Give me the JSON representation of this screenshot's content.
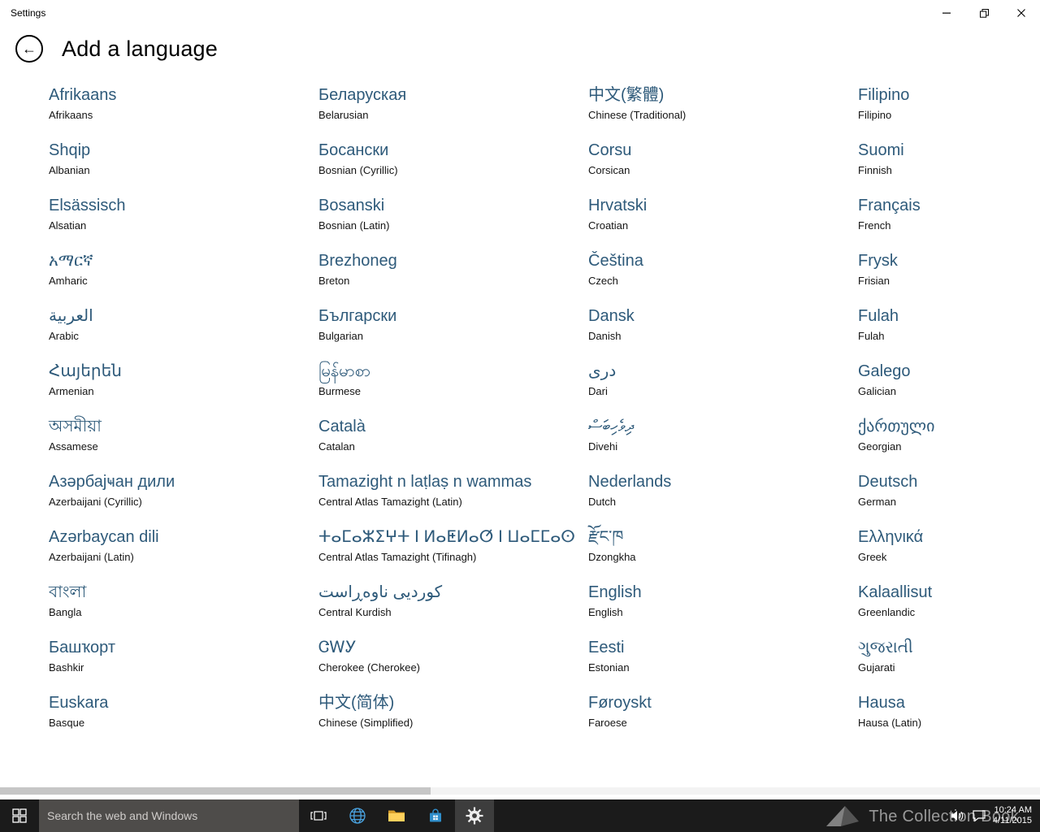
{
  "titlebar": {
    "app_name": "Settings"
  },
  "header": {
    "title": "Add a language"
  },
  "languages": {
    "columns": [
      [
        {
          "native": "Afrikaans",
          "english": "Afrikaans"
        },
        {
          "native": "Shqip",
          "english": "Albanian"
        },
        {
          "native": "Elsässisch",
          "english": "Alsatian"
        },
        {
          "native": "አማርኛ",
          "english": "Amharic"
        },
        {
          "native": "العربية",
          "english": "Arabic"
        },
        {
          "native": "Հայերեն",
          "english": "Armenian"
        },
        {
          "native": "অসমীয়া",
          "english": "Assamese"
        },
        {
          "native": "Азәрбајҹан дили",
          "english": "Azerbaijani (Cyrillic)"
        },
        {
          "native": "Azərbaycan dili",
          "english": "Azerbaijani (Latin)"
        },
        {
          "native": "বাংলা",
          "english": "Bangla"
        },
        {
          "native": "Башҡорт",
          "english": "Bashkir"
        },
        {
          "native": "Euskara",
          "english": "Basque"
        }
      ],
      [
        {
          "native": "Беларуская",
          "english": "Belarusian"
        },
        {
          "native": "Босански",
          "english": "Bosnian (Cyrillic)"
        },
        {
          "native": "Bosanski",
          "english": "Bosnian (Latin)"
        },
        {
          "native": "Brezhoneg",
          "english": "Breton"
        },
        {
          "native": "Български",
          "english": "Bulgarian"
        },
        {
          "native": "မြန်မာစာ",
          "english": "Burmese"
        },
        {
          "native": "Català",
          "english": "Catalan"
        },
        {
          "native": "Tamazight n laṭlaṣ n wammas",
          "english": "Central Atlas Tamazight (Latin)"
        },
        {
          "native": "ⵜⴰⵎⴰⵣⵉⵖⵜ ⵏ ⵍⴰⵟⵍⴰⵚ ⵏ ⵡⴰⵎⵎⴰⵙ",
          "english": "Central Atlas Tamazight (Tifinagh)"
        },
        {
          "native": "کوردیی ناوەڕاست",
          "english": "Central Kurdish"
        },
        {
          "native": "ᏣᎳᎩ",
          "english": "Cherokee (Cherokee)"
        },
        {
          "native": "中文(简体)",
          "english": "Chinese (Simplified)"
        }
      ],
      [
        {
          "native": "中文(繁體)",
          "english": "Chinese (Traditional)"
        },
        {
          "native": "Corsu",
          "english": "Corsican"
        },
        {
          "native": "Hrvatski",
          "english": "Croatian"
        },
        {
          "native": "Čeština",
          "english": "Czech"
        },
        {
          "native": "Dansk",
          "english": "Danish"
        },
        {
          "native": "دری",
          "english": "Dari"
        },
        {
          "native": "ދިވެހިބަސް",
          "english": "Divehi"
        },
        {
          "native": "Nederlands",
          "english": "Dutch"
        },
        {
          "native": "རྫོང་ཁ",
          "english": "Dzongkha"
        },
        {
          "native": "English",
          "english": "English"
        },
        {
          "native": "Eesti",
          "english": "Estonian"
        },
        {
          "native": "Føroyskt",
          "english": "Faroese"
        }
      ],
      [
        {
          "native": "Filipino",
          "english": "Filipino"
        },
        {
          "native": "Suomi",
          "english": "Finnish"
        },
        {
          "native": "Français",
          "english": "French"
        },
        {
          "native": "Frysk",
          "english": "Frisian"
        },
        {
          "native": "Fulah",
          "english": "Fulah"
        },
        {
          "native": "Galego",
          "english": "Galician"
        },
        {
          "native": "ქართული",
          "english": "Georgian"
        },
        {
          "native": "Deutsch",
          "english": "German"
        },
        {
          "native": "Ελληνικά",
          "english": "Greek"
        },
        {
          "native": "Kalaallisut",
          "english": "Greenlandic"
        },
        {
          "native": "ગુજરાતી",
          "english": "Gujarati"
        },
        {
          "native": "Hausa",
          "english": "Hausa (Latin)"
        }
      ]
    ]
  },
  "taskbar": {
    "search_placeholder": "Search the web and Windows",
    "clock": {
      "time": "10:24 AM",
      "date": "4/11/2015"
    }
  },
  "watermark": {
    "text": "The Collection Book"
  },
  "colors": {
    "native_name_text": "#2e5a7a",
    "taskbar_bg": "#1b1b1b",
    "folder_yellow": "#ffd05c",
    "store_blue": "#2f8ecb"
  }
}
